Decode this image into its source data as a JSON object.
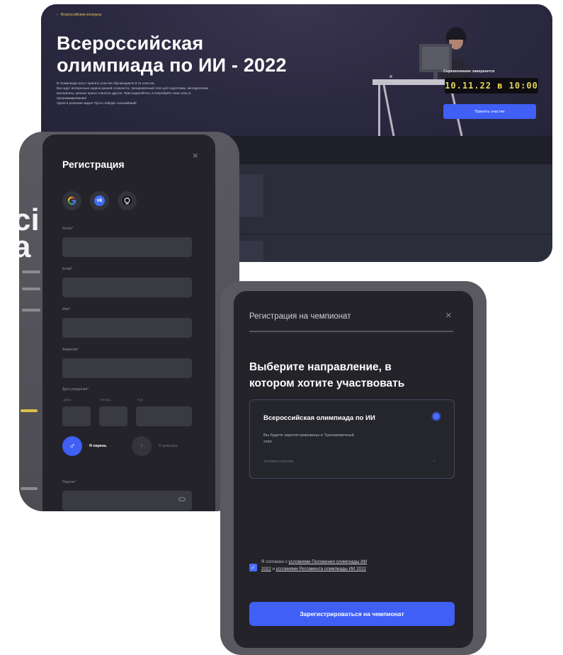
{
  "hero": {
    "back_link": "Всероссийские конкурсы",
    "title_line1": "Всероссийская",
    "title_line2": "олимпиада по ИИ - 2022",
    "description": [
      "В Олимпиаде могут принять участие обучающиеся 8-11 классов.",
      "Вас ждут интересные задачи разной сложности, тренировочный этап для подготовки, методические",
      "материалы, ценные призы и многое другое. Присоединяйтесь и попробуйте свои силы в",
      "программировании!",
      "Удачи в решении задач! Пусть победит сильнейший!"
    ],
    "countdown_label": "Соревнование завершится",
    "countdown": "10.11.22 в 10:00",
    "accept_button": "Принять участие"
  },
  "registration": {
    "title": "Регистрация",
    "close": "×",
    "social": [
      "google-icon",
      "vk-icon",
      "github-icon"
    ],
    "fields": {
      "login": "Логин",
      "email": "Email",
      "name": "Имя",
      "surname": "Фамилия",
      "birthdate": "Дата рождения",
      "day": "День",
      "month": "Месяц",
      "year": "Год",
      "password": "Пароль"
    },
    "required_mark": "*",
    "gender_male": "Я парень",
    "gender_female": "Я девушка"
  },
  "championship": {
    "header": "Регистрация на чемпионат",
    "close": "×",
    "question_line1": "Выберите направление, в",
    "question_line2": "котором хотите участвовать",
    "option": {
      "title": "Всероссийская олимпиада по ИИ",
      "desc_line1": "Вы будете зарегистрированы в Тренировочный",
      "desc_line2": "этап",
      "conditions": "Условия участия"
    },
    "agree": {
      "prefix": "Я согласен с ",
      "link1_line1": "условиями Положения олимпиады ИИ",
      "link1_line2": "2022",
      "middle": " и ",
      "link2": "условиями Регламента олимпиады ИИ 2022"
    },
    "register_button": "Зарегистрироваться на чемпионат"
  },
  "colors": {
    "accent": "#3f5ff5",
    "panel": "#232329",
    "field": "#3a3a42",
    "countdown_text": "#e7d25a"
  }
}
